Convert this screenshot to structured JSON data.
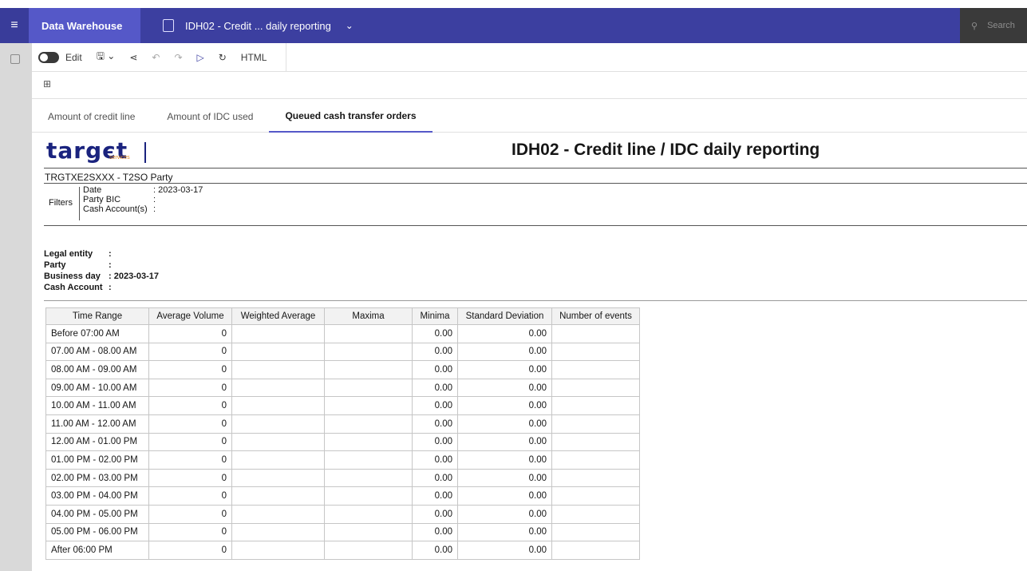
{
  "topbar": {
    "app_name": "Data Warehouse",
    "doc_title": "IDH02 - Credit ... daily reporting",
    "search_placeholder": "Search"
  },
  "toolbar": {
    "edit_label": "Edit",
    "html_label": "HTML"
  },
  "tabs": [
    {
      "label": "Amount of credit line"
    },
    {
      "label": "Amount of IDC used"
    },
    {
      "label": "Queued cash transfer orders",
      "active": true
    }
  ],
  "report": {
    "logo_text": "targєt",
    "logo_sub": "services",
    "title": "IDH02 - Credit line / IDC daily reporting",
    "party_line": "TRGTXE2SXXX - T2SO Party",
    "filters_label": "Filters",
    "filters": [
      {
        "key": "Date",
        "value": ": 2023-03-17"
      },
      {
        "key": "Party BIC",
        "value": ":"
      },
      {
        "key": "Cash Account(s)",
        "value": ":"
      }
    ],
    "info": [
      {
        "key": "Legal entity",
        "value": ":"
      },
      {
        "key": "Party",
        "value": ":"
      },
      {
        "key": "Business day",
        "value": ": 2023-03-17"
      },
      {
        "key": "Cash Account",
        "value": ":"
      }
    ]
  },
  "table": {
    "headers": [
      "Time Range",
      "Average Volume",
      "Weighted Average",
      "Maxima",
      "Minima",
      "Standard Deviation",
      "Number of events"
    ],
    "rows": [
      [
        "Before 07:00 AM",
        "0",
        "",
        "",
        "0.00",
        "0.00",
        ""
      ],
      [
        "07.00 AM - 08.00 AM",
        "0",
        "",
        "",
        "0.00",
        "0.00",
        ""
      ],
      [
        "08.00 AM - 09.00 AM",
        "0",
        "",
        "",
        "0.00",
        "0.00",
        ""
      ],
      [
        "09.00 AM - 10.00 AM",
        "0",
        "",
        "",
        "0.00",
        "0.00",
        ""
      ],
      [
        "10.00 AM - 11.00 AM",
        "0",
        "",
        "",
        "0.00",
        "0.00",
        ""
      ],
      [
        "11.00 AM - 12.00 AM",
        "0",
        "",
        "",
        "0.00",
        "0.00",
        ""
      ],
      [
        "12.00 AM - 01.00 PM",
        "0",
        "",
        "",
        "0.00",
        "0.00",
        ""
      ],
      [
        "01.00 PM - 02.00 PM",
        "0",
        "",
        "",
        "0.00",
        "0.00",
        ""
      ],
      [
        "02.00 PM - 03.00 PM",
        "0",
        "",
        "",
        "0.00",
        "0.00",
        ""
      ],
      [
        "03.00 PM - 04.00 PM",
        "0",
        "",
        "",
        "0.00",
        "0.00",
        ""
      ],
      [
        "04.00 PM - 05.00 PM",
        "0",
        "",
        "",
        "0.00",
        "0.00",
        ""
      ],
      [
        "05.00 PM - 06.00 PM",
        "0",
        "",
        "",
        "0.00",
        "0.00",
        ""
      ],
      [
        "After 06:00 PM",
        "0",
        "",
        "",
        "0.00",
        "0.00",
        ""
      ]
    ]
  }
}
